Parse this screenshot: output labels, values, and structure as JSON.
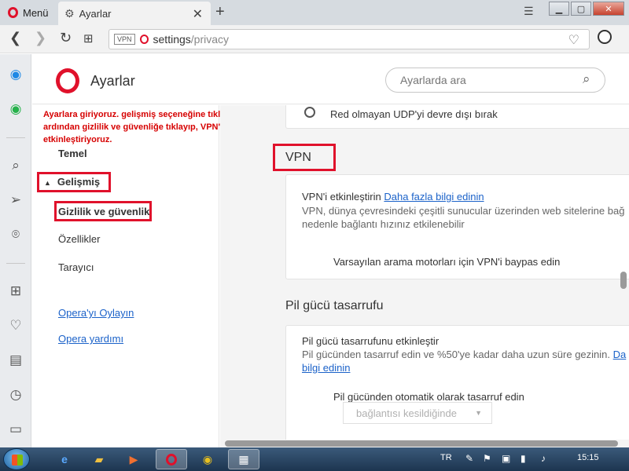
{
  "browser": {
    "menu_label": "Menü",
    "tab_title": "Ayarlar",
    "url_host": "settings",
    "url_path": "/privacy",
    "vpn_badge": "VPN"
  },
  "settings": {
    "title": "Ayarlar",
    "search_placeholder": "Ayarlarda ara"
  },
  "annotation": "Ayarlara giriyoruz. gelişmiş seçeneğine tıklıyoruz. ardından gizlilik ve güvenliğe tıklayıp, VPN'yi etkinleştiriyoruz.",
  "nav": {
    "temel": "Temel",
    "gelismis": "Gelişmiş",
    "gizlilik": "Gizlilik ve güvenlik",
    "ozellikler": "Özellikler",
    "tarayici": "Tarayıcı",
    "oyla": "Opera'yı Oylayın",
    "yardim": "Opera yardımı"
  },
  "content": {
    "udp_option": "Red olmayan UDP'yi devre dışı bırak",
    "vpn_title": "VPN",
    "vpn_enable": "VPN'i etkinleştirin",
    "vpn_more_link": "Daha fazla bilgi edinin",
    "vpn_desc_1": "VPN, dünya çevresindeki çeşitli sunucular üzerinden web sitelerine bağ",
    "vpn_desc_2": "nedenle bağlantı hızınız etkilenebilir",
    "vpn_bypass": "Varsayılan arama motorları için VPN'i baypas edin",
    "battery_title": "Pil gücü tasarrufu",
    "battery_enable": "Pil gücü tasarrufunu etkinleştir",
    "battery_desc_1": "Pil gücünden tasarruf edin ve %50'ye kadar daha uzun süre gezinin.",
    "battery_link_1": "Da",
    "battery_link_2": "bilgi edinin",
    "battery_auto": "Pil gücünden otomatik olarak tasarruf edin",
    "battery_select_value": "bağlantısı kesildiğinde"
  },
  "taskbar": {
    "lang": "TR",
    "time": "15:15"
  },
  "colors": {
    "opera_red": "#e0112b",
    "link_blue": "#1b62c9",
    "annotation_red": "#d60000"
  }
}
